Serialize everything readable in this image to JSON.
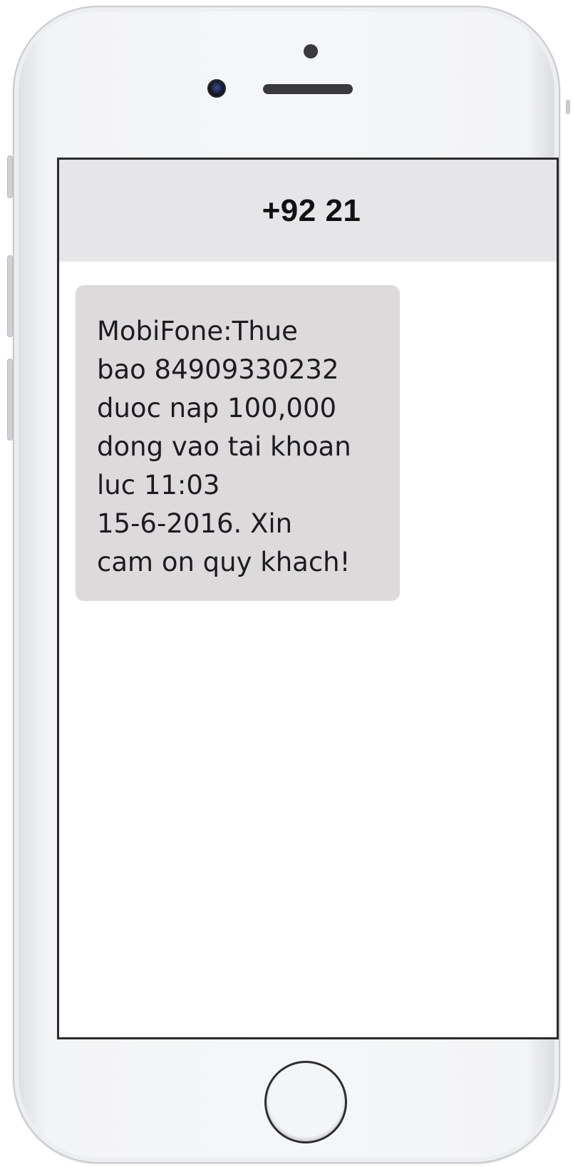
{
  "conversation": {
    "contact_number": "+92 21",
    "messages": [
      {
        "text": "MobiFone:Thue\nbao 84909330232\nduoc nap 100,000\ndong vao tai khoan\nluc 11:03\n15-6-2016. Xin\ncam on quy khach!",
        "direction": "incoming"
      }
    ]
  },
  "colors": {
    "header_background": "#e6e6e8",
    "incoming_bubble": "#dcdadb",
    "screen_background": "#ffffff",
    "phone_body": "#f5f6f8"
  },
  "icons": {
    "front_camera": "front-camera-icon",
    "earpiece": "speaker-icon",
    "proximity_sensor": "sensor-icon",
    "home": "home-button"
  }
}
